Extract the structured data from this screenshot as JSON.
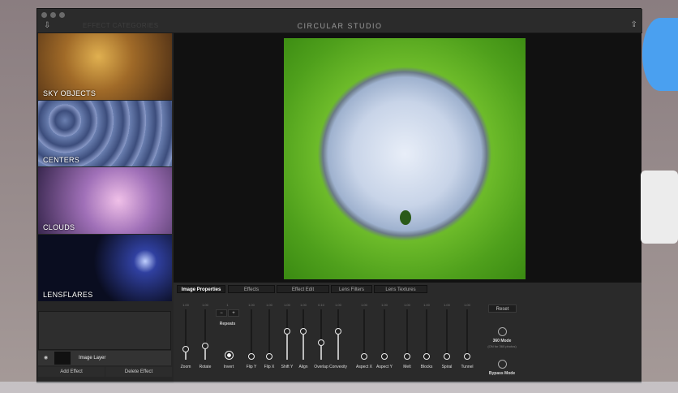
{
  "window": {
    "title": "CIRCULAR STUDIO",
    "categories_label": "EFFECT CATEGORIES"
  },
  "sidebar": {
    "categories": [
      {
        "label": "SKY OBJECTS"
      },
      {
        "label": "CENTERS"
      },
      {
        "label": "CLOUDS"
      },
      {
        "label": "LENSFLARES"
      }
    ],
    "layer": {
      "label": "Image Layer"
    },
    "add_effect": "Add Effect",
    "delete_effect": "Delete Effect"
  },
  "tabs": [
    {
      "label": "Image Properties",
      "active": true
    },
    {
      "label": "Effects"
    },
    {
      "label": "Effect Edit"
    },
    {
      "label": "Lens Filters"
    },
    {
      "label": "Lens Textures"
    }
  ],
  "repeats": {
    "label": "Repeats",
    "minus": "−",
    "plus": "+",
    "value": "1"
  },
  "sliders": [
    {
      "label": "Zoom",
      "value": "1.00",
      "level": 0.15
    },
    {
      "label": "Rotate",
      "value": "1.00",
      "level": 0.22
    },
    {
      "label": "Flip Y",
      "value": "1.00",
      "level": 0
    },
    {
      "label": "Flip X",
      "value": "1.00",
      "level": 0
    },
    {
      "label": "Shift Y",
      "value": "1.00",
      "level": 0.53
    },
    {
      "label": "Align",
      "value": "1.00",
      "level": 0.53
    },
    {
      "label": "Overlap",
      "value": "0.10",
      "level": 0.3
    },
    {
      "label": "Convexity",
      "value": "1.00",
      "level": 0.53
    },
    {
      "label": "Aspect X",
      "value": "1.00",
      "level": 0
    },
    {
      "label": "Aspect Y",
      "value": "1.00",
      "level": 0
    },
    {
      "label": "Melt",
      "value": "1.00",
      "level": 0
    },
    {
      "label": "Blocks",
      "value": "1.00",
      "level": 0
    },
    {
      "label": "Spiral",
      "value": "1.00",
      "level": 0
    },
    {
      "label": "Tunnel",
      "value": "1.00",
      "level": 0
    }
  ],
  "invert": {
    "label": "Invert"
  },
  "reset": "Reset",
  "mode360": {
    "label": "360 Mode",
    "hint": "(ON for 360 photos)"
  },
  "bypass": {
    "label": "Bypass Mode"
  }
}
